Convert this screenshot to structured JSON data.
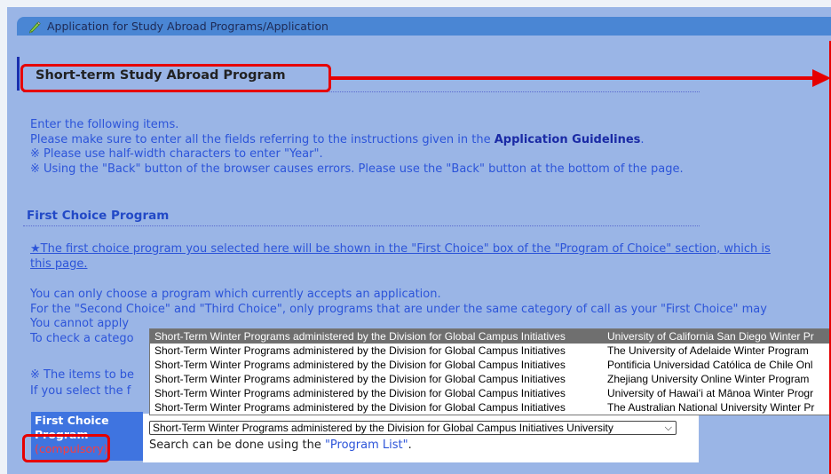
{
  "titlebar": {
    "title": "Application for Study Abroad Programs/Application"
  },
  "section": {
    "title": "Short-term Study Abroad Program"
  },
  "instructions": {
    "line1": "Enter the following items.",
    "line2_pre": "Please make sure to enter all the fields referring to the instructions given in the ",
    "line2_link": "Application Guidelines",
    "line2_post": ".",
    "line3": "※ Please use half-width characters to enter \"Year\".",
    "line4": "※ Using the \"Back\" button of the browser causes errors. Please use the \"Back\" button at the bottom of the page."
  },
  "first_choice": {
    "title": "First Choice Program",
    "star_line1": "★The first choice program you selected here will be shown in the \"First Choice\" box of the \"Program of Choice\" section, which is",
    "star_line2": "this page.",
    "note1": "You can only choose a program which currently accepts an application.",
    "note2": "For the \"Second Choice\" and \"Third Choice\", only programs that are under the same category of call as your \"First Choice\" may",
    "note3": "You cannot apply",
    "note4": "To check a catego",
    "note5": "※ The items to be",
    "note6": "If you select the f",
    "label": "First Choice Program",
    "compulsory": "(compulsory)",
    "selected_value": "Short-Term Winter Programs administered by the Division for Global Campus Initiatives   University",
    "search_pre": "Search can be done using the ",
    "search_link": "\"Program List\"",
    "search_post": ".",
    "options": [
      {
        "category": "Short-Term Winter Programs administered by the Division for Global Campus Initiatives",
        "program": "University of California San Diego Winter Pr",
        "selected": true
      },
      {
        "category": "Short-Term Winter Programs administered by the Division for Global Campus Initiatives",
        "program": "The University of Adelaide Winter Program"
      },
      {
        "category": "Short-Term Winter Programs administered by the Division for Global Campus Initiatives",
        "program": "Pontificia Universidad Católica de Chile Onl"
      },
      {
        "category": "Short-Term Winter Programs administered by the Division for Global Campus Initiatives",
        "program": "Zhejiang University Online Winter Program"
      },
      {
        "category": "Short-Term Winter Programs administered by the Division for Global Campus Initiatives",
        "program": "University of Hawaiʻi at Mānoa Winter Progr"
      },
      {
        "category": "Short-Term Winter Programs administered by the Division for Global Campus Initiatives",
        "program": "The Australian National University Winter Pr"
      }
    ]
  }
}
